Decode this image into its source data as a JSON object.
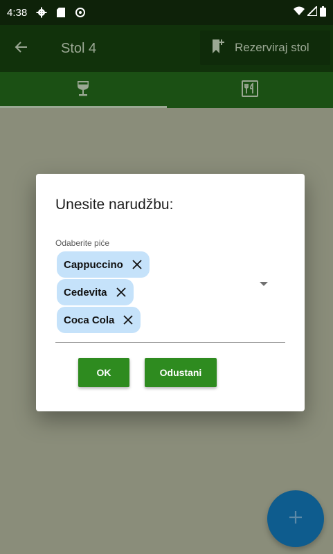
{
  "status_bar": {
    "time": "4:38",
    "icons": [
      "gear-icon",
      "sd-card-icon",
      "sync-icon",
      "wifi-icon",
      "signal-icon",
      "battery-icon"
    ]
  },
  "app_bar": {
    "back_icon": "arrow-back-icon",
    "title": "Stol 4",
    "reserve_label": "Rezerviraj stol",
    "reserve_icon": "bookmark-add-icon"
  },
  "tabs": [
    {
      "icon": "wine-glass-icon",
      "selected": true
    },
    {
      "icon": "restaurant-menu-icon",
      "selected": false
    }
  ],
  "dialog": {
    "title": "Unesite narudžbu:",
    "field_label": "Odaberite piće",
    "chips": [
      "Cappuccino",
      "Cedevita",
      "Coca Cola"
    ],
    "ok_label": "OK",
    "cancel_label": "Odustani"
  },
  "fab": {
    "icon": "plus-icon"
  },
  "colors": {
    "app_bar": "#11320b",
    "tab_bar": "#1b5014",
    "chip": "#c5e2fa",
    "button": "#2e8b1f",
    "fab": "#0e5c8e",
    "scrim": "#8a8d7a"
  }
}
